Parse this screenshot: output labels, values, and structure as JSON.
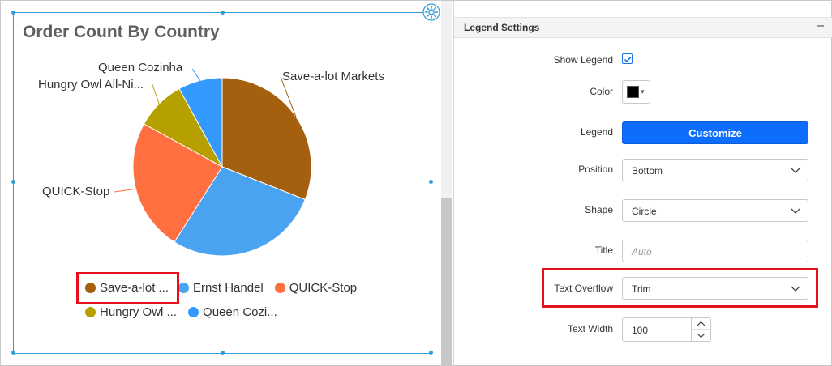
{
  "chart_data": {
    "type": "pie",
    "title": "Order Count By Country",
    "slices": [
      {
        "name": "Save-a-lot Markets",
        "value": 31,
        "color": "#a5600f"
      },
      {
        "name": "Ernst Handel",
        "value": 28,
        "color": "#4aa3f0"
      },
      {
        "name": "QUICK-Stop",
        "value": 24,
        "color": "#ff6f3f"
      },
      {
        "name": "Hungry Owl All-Night Grocers",
        "value": 9,
        "color": "#b5a000"
      },
      {
        "name": "Queen Cozinha",
        "value": 8,
        "color": "#3399ff"
      }
    ],
    "data_labels": {
      "save_a_lot": "Save-a-lot Markets",
      "queen": "Queen Cozinha",
      "hungry": "Hungry Owl All-Ni...",
      "quick": "QUICK-Stop"
    },
    "legend": {
      "placement": "bottom",
      "shape": "circle",
      "items": [
        "Save-a-lot ...",
        "Ernst Handel",
        "QUICK-Stop",
        "Hungry Owl ...",
        "Queen Cozi..."
      ]
    }
  },
  "panel": {
    "title": "Legend Settings",
    "collapse_icon": "minus-icon",
    "show_legend_label": "Show Legend",
    "show_legend_checked": true,
    "color_label": "Color",
    "color_value": "#000000",
    "legend_label": "Legend",
    "customize_label": "Customize",
    "position_label": "Position",
    "position_value": "Bottom",
    "shape_label": "Shape",
    "shape_value": "Circle",
    "title_label": "Title",
    "title_placeholder": "Auto",
    "text_overflow_label": "Text Overflow",
    "text_overflow_value": "Trim",
    "text_width_label": "Text Width",
    "text_width_value": "100"
  },
  "colors": {
    "accent_blue": "#0d6efd",
    "selection_border": "#2e9bd6",
    "highlight_red": "#e0121c"
  }
}
